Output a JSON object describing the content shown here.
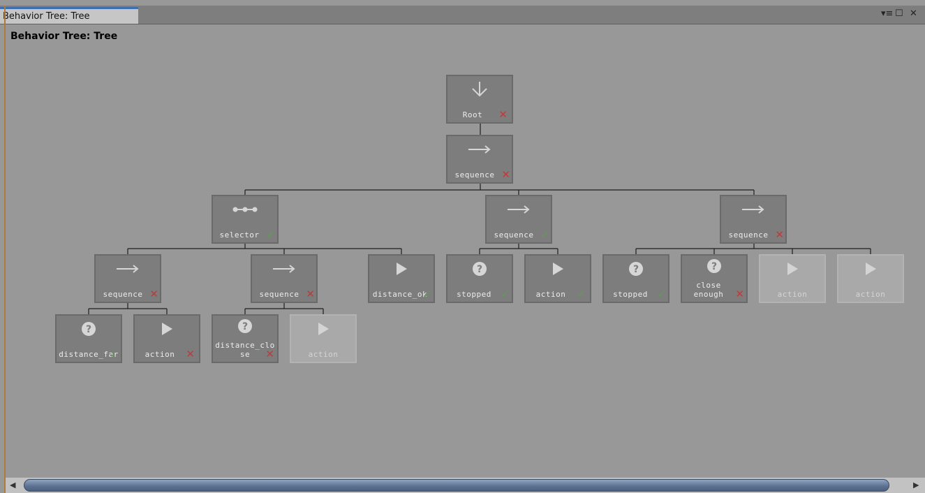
{
  "window": {
    "tab_label": "Behavior Tree: Tree",
    "heading": "Behavior Tree: Tree",
    "controls": [
      "menu-icon",
      "maximize-icon",
      "close-icon"
    ]
  },
  "colors": {
    "background": "#989898",
    "node": "#7d7d7d",
    "node_inactive": "#a9a9a9",
    "fail": "#c43838",
    "success": "#5e9d4f",
    "tab_accent": "#3d6fb3"
  },
  "tree": {
    "nodes": [
      {
        "id": "root",
        "type": "root",
        "label": "Root",
        "status": "fail",
        "active": true
      },
      {
        "id": "seq_main",
        "type": "sequence",
        "label": "sequence",
        "status": "fail",
        "active": true,
        "parent": "root"
      },
      {
        "id": "selector",
        "type": "selector",
        "label": "selector",
        "status": "success",
        "active": true,
        "parent": "seq_main"
      },
      {
        "id": "seq_mid",
        "type": "sequence",
        "label": "sequence",
        "status": "success",
        "active": true,
        "parent": "seq_main"
      },
      {
        "id": "seq_right",
        "type": "sequence",
        "label": "sequence",
        "status": "fail",
        "active": true,
        "parent": "seq_main"
      },
      {
        "id": "seq_a",
        "type": "sequence",
        "label": "sequence",
        "status": "fail",
        "active": true,
        "parent": "selector"
      },
      {
        "id": "seq_b",
        "type": "sequence",
        "label": "sequence",
        "status": "fail",
        "active": true,
        "parent": "selector"
      },
      {
        "id": "distance_ok",
        "type": "action",
        "label": "distance_ok",
        "status": "success",
        "active": true,
        "parent": "selector"
      },
      {
        "id": "stopped_1",
        "type": "condition",
        "label": "stopped",
        "status": "success",
        "active": true,
        "parent": "seq_mid"
      },
      {
        "id": "action_mid",
        "type": "action",
        "label": "action",
        "status": "success",
        "active": true,
        "parent": "seq_mid"
      },
      {
        "id": "stopped_2",
        "type": "condition",
        "label": "stopped",
        "status": "success",
        "active": true,
        "parent": "seq_right"
      },
      {
        "id": "close_enough",
        "type": "condition",
        "label": "close\nenough",
        "status": "fail",
        "active": true,
        "parent": "seq_right"
      },
      {
        "id": "action_r1",
        "type": "action",
        "label": "action",
        "status": "none",
        "active": false,
        "parent": "seq_right"
      },
      {
        "id": "action_r2",
        "type": "action",
        "label": "action",
        "status": "none",
        "active": false,
        "parent": "seq_right"
      },
      {
        "id": "distance_far",
        "type": "condition",
        "label": "distance_far",
        "status": "success",
        "active": true,
        "parent": "seq_a"
      },
      {
        "id": "action_a",
        "type": "action",
        "label": "action",
        "status": "fail",
        "active": true,
        "parent": "seq_a"
      },
      {
        "id": "distance_close",
        "type": "condition",
        "label": "distance_clo\nse",
        "status": "fail",
        "active": true,
        "parent": "seq_b"
      },
      {
        "id": "action_b",
        "type": "action",
        "label": "action",
        "status": "none",
        "active": false,
        "parent": "seq_b"
      }
    ]
  }
}
